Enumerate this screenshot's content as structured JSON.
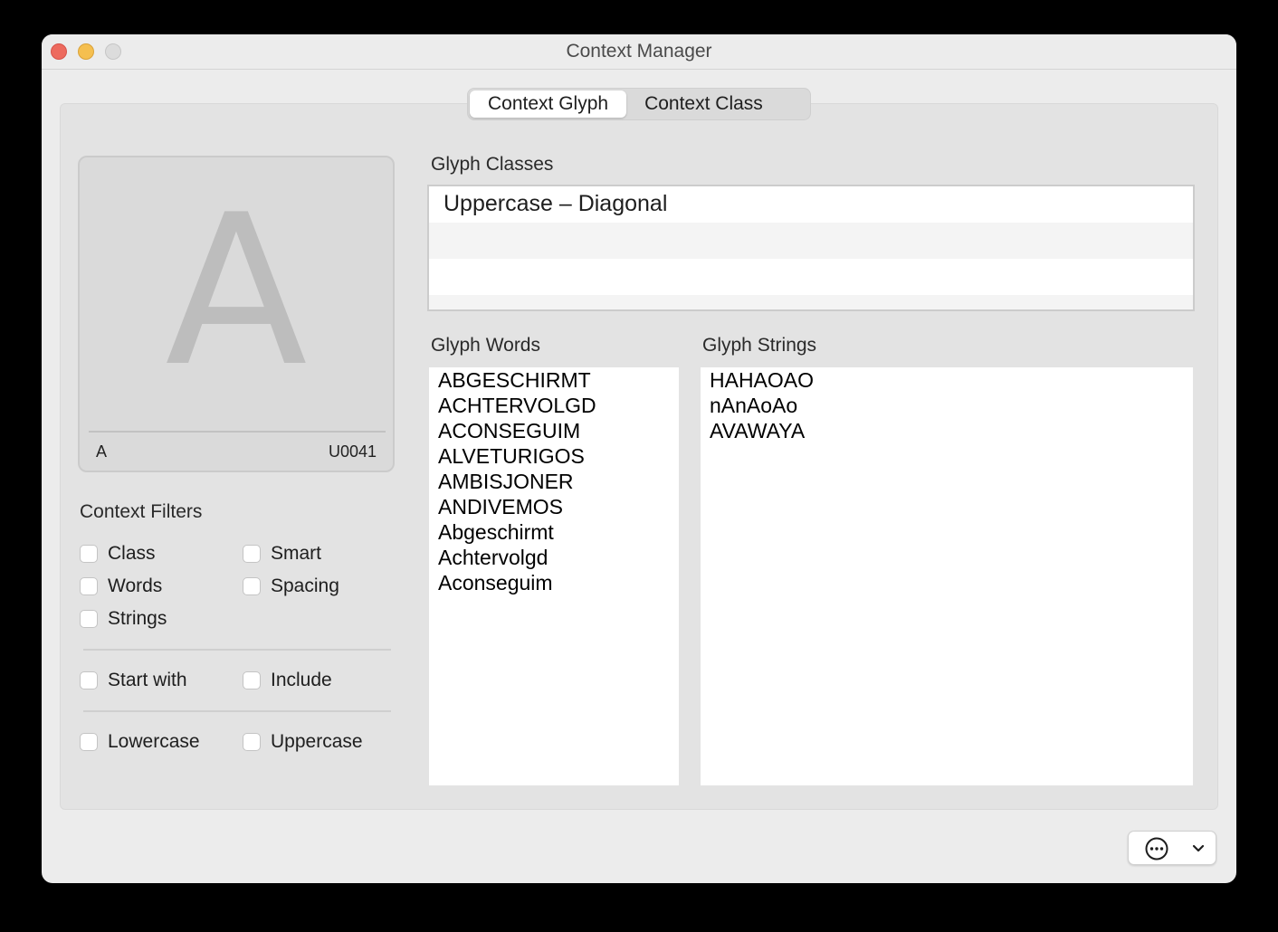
{
  "window": {
    "title": "Context Manager"
  },
  "tabs": [
    {
      "label": "Context Glyph",
      "active": true
    },
    {
      "label": "Context Class",
      "active": false
    }
  ],
  "glyph": {
    "character": "A",
    "name": "A",
    "unicode": "U0041"
  },
  "filters": {
    "title": "Context Filters",
    "class_label": "Class",
    "smart_label": "Smart",
    "words_label": "Words",
    "spacing_label": "Spacing",
    "strings_label": "Strings",
    "start_with_label": "Start with",
    "include_label": "Include",
    "lowercase_label": "Lowercase",
    "uppercase_label": "Uppercase"
  },
  "glyph_classes": {
    "title": "Glyph Classes",
    "items": [
      "Uppercase – Diagonal"
    ]
  },
  "glyph_words": {
    "title": "Glyph Words",
    "items": [
      "ABGESCHIRMT",
      "ACHTERVOLGD",
      "ACONSEGUIM",
      "ALVETURIGOS",
      "AMBISJONER",
      "ANDIVEMOS",
      "Abgeschirmt",
      "Achtervolgd",
      "Aconseguim"
    ]
  },
  "glyph_strings": {
    "title": "Glyph Strings",
    "items": [
      "HAHAOAO",
      "nAnAoAo",
      "AVAWAYA"
    ]
  },
  "icons": {
    "action": "ellipsis-circle-icon",
    "dropdown": "chevron-down-icon"
  }
}
